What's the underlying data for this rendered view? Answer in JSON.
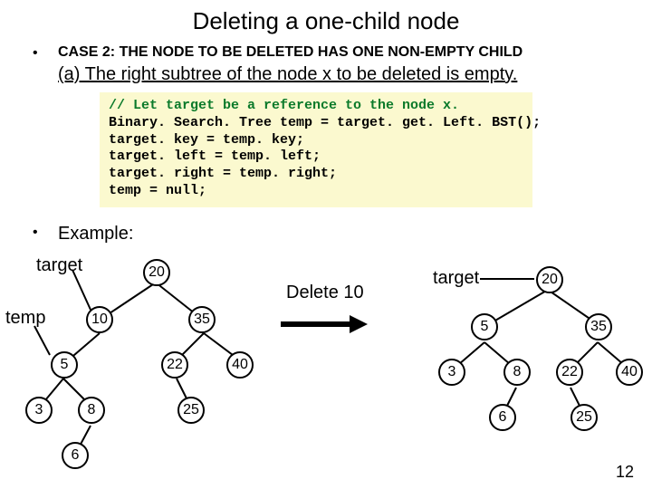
{
  "title": "Deleting a one-child node",
  "case_line": "CASE 2: THE NODE TO BE DELETED HAS ONE NON-EMPTY CHILD",
  "sub_a": "(a) The right subtree of the node x to be deleted is empty.",
  "code": {
    "c1": "// Let target be a reference to the node x.",
    "l2": "Binary. Search. Tree temp = target. get. Left. BST();",
    "l3": "target. key = temp. key;",
    "l4": "target. left = temp. left;",
    "l5": "target. right = temp. right;",
    "l6": "temp = null;"
  },
  "example_label": "Example:",
  "labels": {
    "target": "target",
    "temp": "temp"
  },
  "delete_text": "Delete 10",
  "left_tree": {
    "n20": "20",
    "n10": "10",
    "n35": "35",
    "n5": "5",
    "n22": "22",
    "n40": "40",
    "n3": "3",
    "n8": "8",
    "n25": "25",
    "n6": "6"
  },
  "right_tree": {
    "n20": "20",
    "n5": "5",
    "n35": "35",
    "n3": "3",
    "n8": "8",
    "n22": "22",
    "n40": "40",
    "n6": "6",
    "n25": "25"
  },
  "page": "12"
}
